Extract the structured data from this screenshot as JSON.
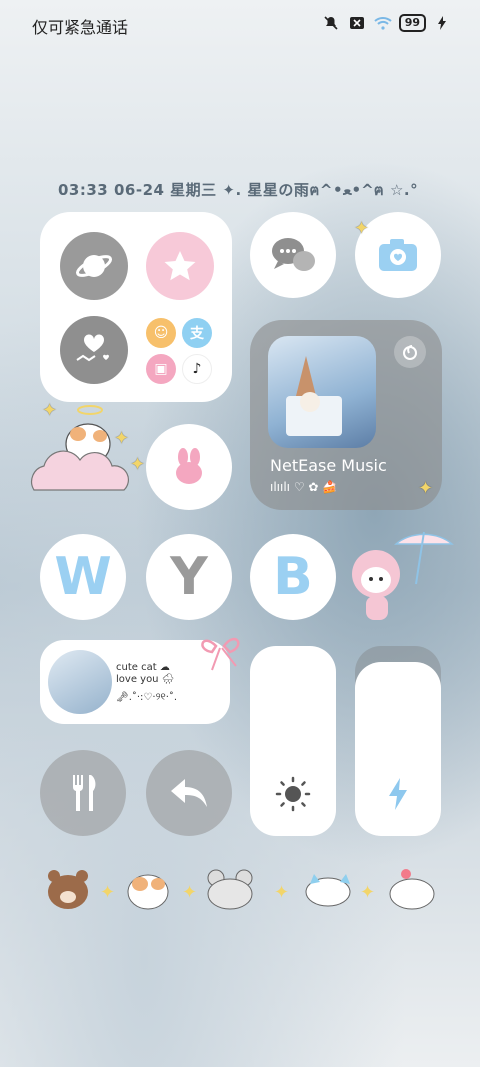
{
  "status_bar": {
    "carrier_text": "仅可紧急通话",
    "battery_level": "99",
    "icons": [
      "mute-icon",
      "sim-off-icon",
      "wifi-icon",
      "battery-icon",
      "charging-icon"
    ]
  },
  "info_line": {
    "text": "03:33  06-24 星期三  ✦. 星星の雨ฅ^•ﻌ•^ฅ ☆.°"
  },
  "app_folder": {
    "apps": [
      {
        "icon": "planet-icon"
      },
      {
        "icon": "star-icon"
      },
      {
        "icon": "hearts-icon"
      },
      {
        "icon": "mini-apps-icon"
      }
    ]
  },
  "apps": {
    "messages_icon": "chat-bubbles-icon",
    "camera_icon": "camera-icon",
    "rabbit_icon": "bunny-icon",
    "letters": [
      "W",
      "Y",
      "B"
    ],
    "fork_icon": "fork-knife-icon",
    "back_icon": "back-arrow-icon"
  },
  "music_widget": {
    "title": "NetEase Music",
    "deco": "ılıılı ♡ ✿ 🍰",
    "app_icon": "netease-icon"
  },
  "photo_widget": {
    "line1": "cute cat ☁",
    "line2": "love you 🌧",
    "deco": "🗝.˚·:♡·୨୧·˚."
  },
  "controls": {
    "brightness_icon": "sun-icon",
    "power_icon": "bolt-icon"
  },
  "colors": {
    "accent_blue": "#9bd0f2",
    "accent_pink": "#f7c9d8",
    "icon_grey": "#9a9a9a"
  }
}
